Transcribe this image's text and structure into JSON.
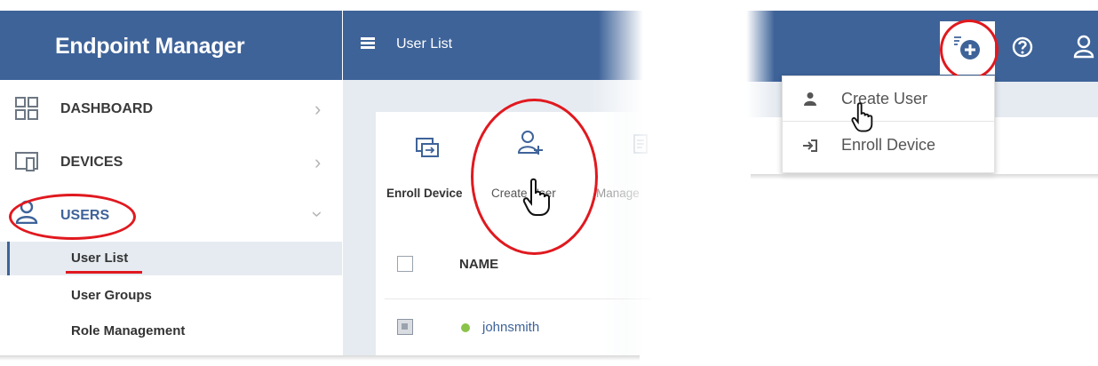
{
  "left_panel": {
    "app_title": "Endpoint Manager",
    "topbar_title": "User List",
    "nav": [
      {
        "label": "DASHBOARD",
        "icon": "dashboard-grid-icon"
      },
      {
        "label": "DEVICES",
        "icon": "devices-icon"
      },
      {
        "label": "USERS",
        "icon": "user-icon"
      }
    ],
    "users_submenu": [
      "User List",
      "User Groups",
      "Role Management"
    ],
    "toolbar": {
      "enroll_device": "Enroll Device",
      "create_user": "Create User",
      "manage": "Manage"
    },
    "table": {
      "column_name": "NAME",
      "rows": [
        {
          "name": "johnsmith",
          "status": "online"
        }
      ]
    }
  },
  "right_panel": {
    "dropdown": [
      "Create User",
      "Enroll Device"
    ]
  },
  "colors": {
    "header_blue": "#3e6399",
    "highlight_red": "#e0191f",
    "link_blue": "#3e6399",
    "online_green": "#8bc34a"
  }
}
